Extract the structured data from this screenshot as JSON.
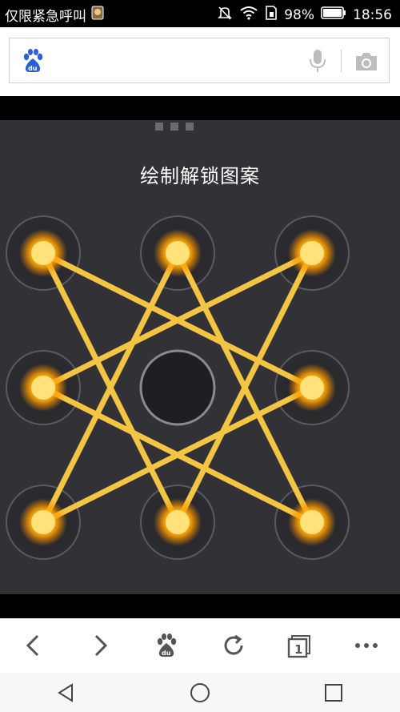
{
  "status_bar": {
    "notification_text": "仅限紧急呼叫",
    "battery": "98%",
    "time": "18:56"
  },
  "search": {
    "placeholder": "",
    "icons": [
      "baidu-logo-icon",
      "microphone-icon",
      "camera-icon"
    ]
  },
  "lock": {
    "title": "绘制解锁图案",
    "pattern_path": [
      0,
      5,
      6,
      1,
      8,
      3,
      2,
      7,
      0
    ],
    "dots_active": [
      true,
      true,
      true,
      true,
      false,
      true,
      true,
      true,
      true
    ],
    "colors": {
      "background": "#323236",
      "line": "#f4c542",
      "dot_glow": "#ffb300",
      "dot_core": "#ffe27a"
    }
  },
  "toolbar": {
    "icons": [
      "back-icon",
      "forward-icon",
      "baidu-home-icon",
      "refresh-icon",
      "tabs-icon",
      "more-icon"
    ],
    "tab_count": "1"
  },
  "navbar": {
    "icons": [
      "nav-back-icon",
      "nav-home-icon",
      "nav-recents-icon"
    ]
  }
}
